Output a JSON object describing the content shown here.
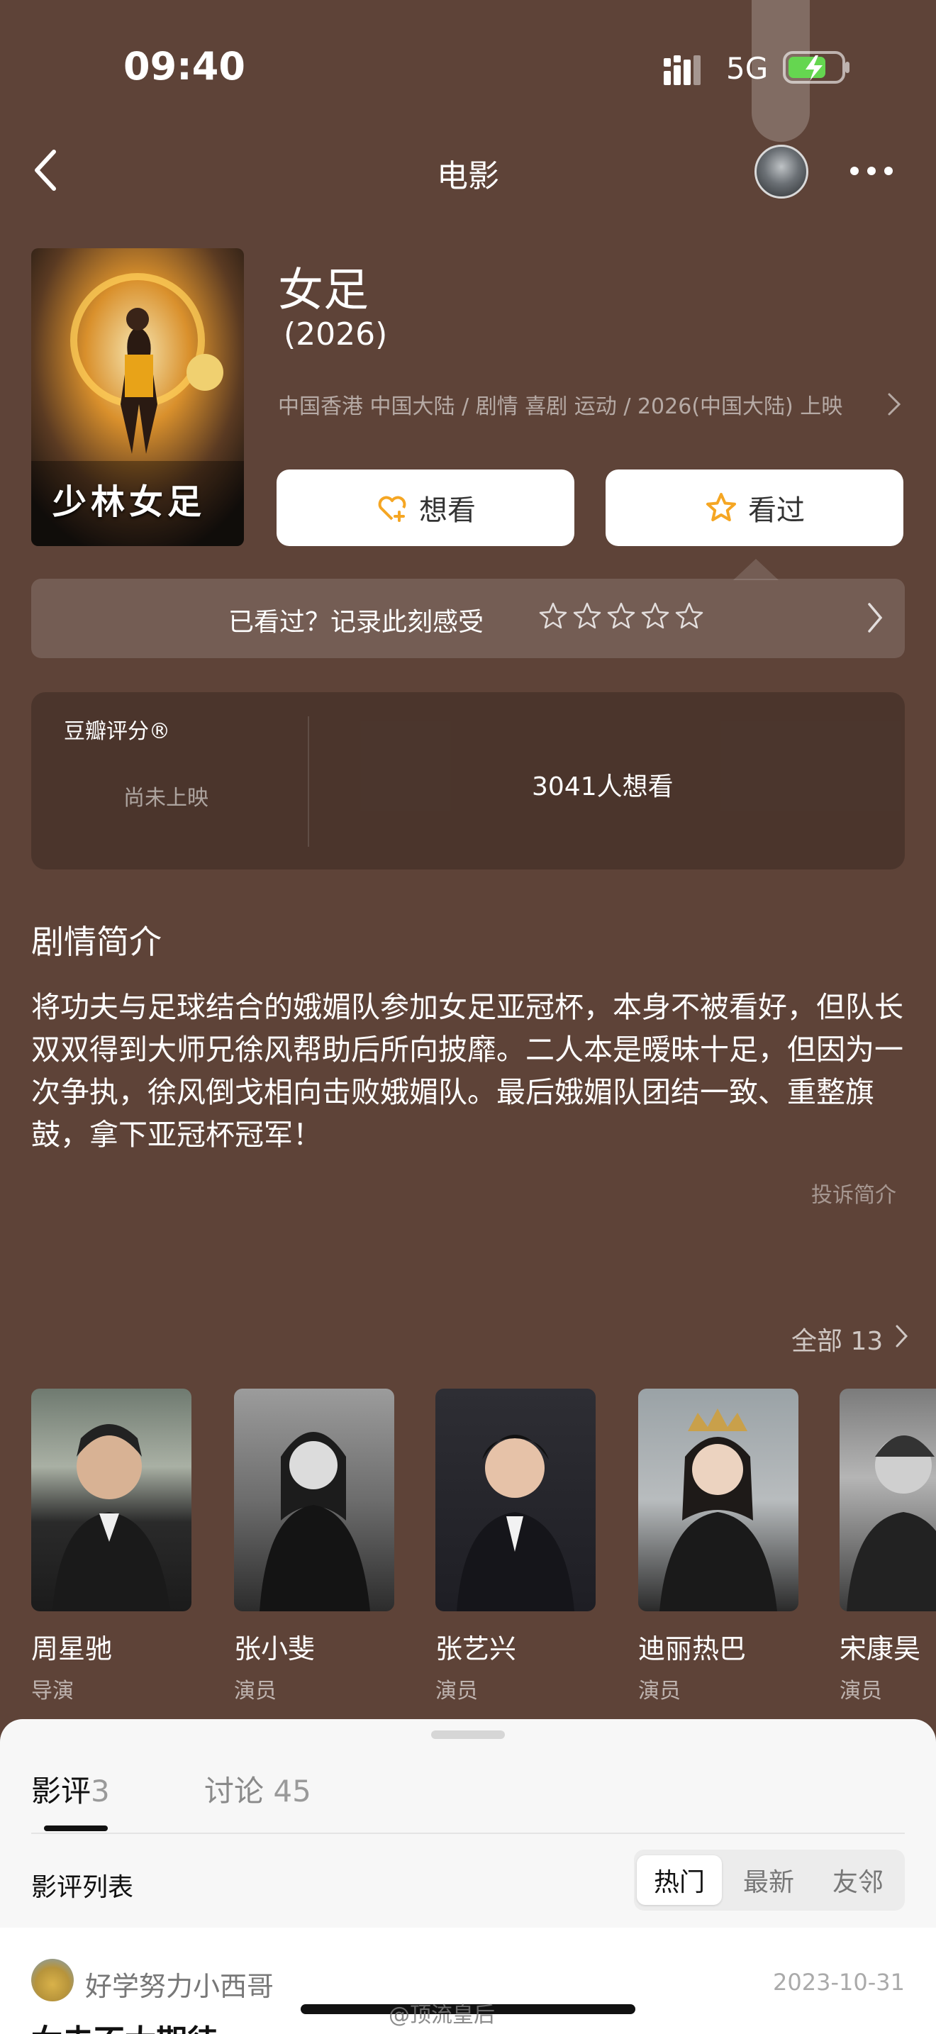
{
  "status_bar": {
    "time": "09:40",
    "network": "5G",
    "signal_icon": "signal-bars-icon",
    "battery_icon": "battery-charging-icon"
  },
  "nav": {
    "title": "电影",
    "back_icon": "chevron-left-icon",
    "more_icon": "more-dots-icon"
  },
  "movie": {
    "title": "女足",
    "year": "(2026)",
    "meta": "中国香港 中国大陆 / 剧情 喜剧 运动 / 2026(中国大陆) 上映",
    "poster_text": "少林女足"
  },
  "actions": {
    "want_label": "想看",
    "watched_label": "看过"
  },
  "record": {
    "prompt": "已看过？记录此刻感受",
    "stars": 0
  },
  "rating": {
    "title": "豆瓣评分®",
    "status": "尚未上映",
    "wish_count": "3041人想看"
  },
  "synopsis": {
    "heading": "剧情简介",
    "text": "将功夫与足球结合的娥媚队参加女足亚冠杯，本身不被看好，但队长双双得到大师兄徐风帮助后所向披靡。二人本是暧昧十足，但因为一次争执，徐风倒戈相向击败娥媚队。最后娥媚队团结一致、重整旗鼓，拿下亚冠杯冠军！",
    "report": "投诉简介"
  },
  "cast": {
    "all_label": "全部 13",
    "members": [
      {
        "name": "周星驰",
        "role": "导演"
      },
      {
        "name": "张小斐",
        "role": "演员"
      },
      {
        "name": "张艺兴",
        "role": "演员"
      },
      {
        "name": "迪丽热巴",
        "role": "演员"
      },
      {
        "name": "宋康昊",
        "role": "演员"
      }
    ]
  },
  "sheet": {
    "tabs": [
      {
        "label": "影评",
        "count": "3"
      },
      {
        "label": "讨论",
        "count": "45"
      }
    ],
    "list_label": "影评列表",
    "sort_options": [
      "热门",
      "最新",
      "友邻"
    ],
    "review": {
      "author": "好学努力小西哥",
      "date": "2023-10-31",
      "title_peek": "女去不太期待"
    }
  },
  "watermark": "@顶流皇后",
  "colors": {
    "background": "#5e4338",
    "sheet": "#f7f7f7",
    "accent": "#f5a623"
  }
}
